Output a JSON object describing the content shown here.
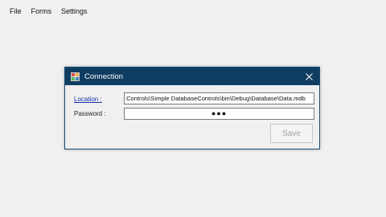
{
  "menubar": {
    "items": [
      "File",
      "Forms",
      "Settings"
    ]
  },
  "dialog": {
    "title": "Connection",
    "location_label": "Location :",
    "location_value": "Controls\\Simple DatabaseControls\\bin\\Debug\\Database\\Data.mdb",
    "password_label": "Password :",
    "password_mask": "●●●",
    "save_label": "Save"
  },
  "colors": {
    "titlebar": "#0f3d62",
    "link": "#1a2fb0",
    "disabled_text": "#a0a0a0"
  },
  "icons": {
    "dialog_icon": "app-grid-icon",
    "close": "close-icon"
  }
}
